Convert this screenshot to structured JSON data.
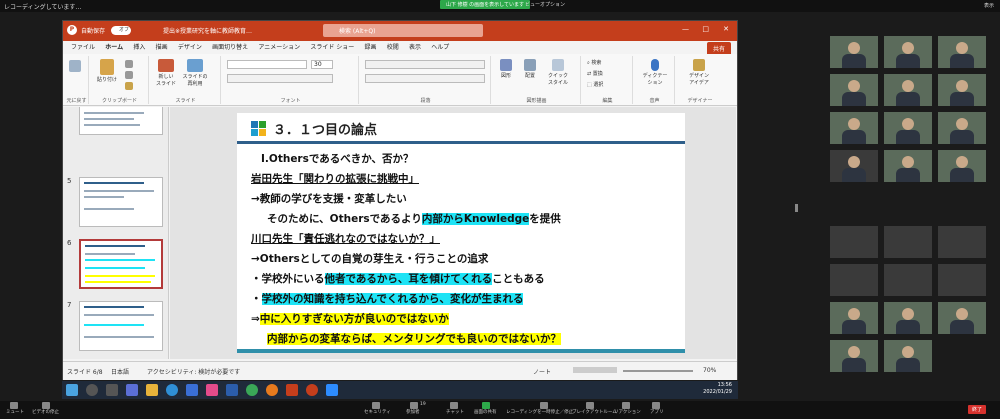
{
  "zoom": {
    "recording_label": "レコーディングしています…",
    "share_banner": "山下 修樹 の画面を表示しています",
    "view_options": "ビューオプション",
    "display_label": "表示",
    "bottom": {
      "mute": "ミュート",
      "video": "ビデオの停止",
      "security": "セキュリティ",
      "participants": "参加者",
      "participants_count": "19",
      "chat": "チャット",
      "share": "画面の共有",
      "record": "レコーディングを一時停止／停止",
      "breakout": "ブレイクアウトルーム",
      "reactions": "リアクション",
      "apps": "アプリ",
      "end": "終了"
    }
  },
  "ppt": {
    "autosave": "自動保存",
    "toggle": "オフ",
    "doc_title": "提出※授業研究を軸に教師教育…",
    "search_placeholder": "検索 (Alt+Q)",
    "menu": [
      "ファイル",
      "ホーム",
      "挿入",
      "描画",
      "デザイン",
      "画面切り替え",
      "アニメーション",
      "スライド ショー",
      "録画",
      "校閲",
      "表示",
      "ヘルプ"
    ],
    "share_button": "共有",
    "ribbon": {
      "undo": "元に戻す",
      "paste": "貼り付け",
      "clipboard": "クリップボード",
      "new_slide": "新しい\nスライド",
      "reuse_slide": "スライドの\n再利用",
      "slide_group": "スライド",
      "font_group": "フォント",
      "font_size": "30",
      "paragraph_group": "段落",
      "draw_group": "図形描画",
      "shapes": "図形",
      "arrange": "配置",
      "quick_styles": "クイック\nスタイル",
      "find": "検索",
      "replace": "置換",
      "select": "選択",
      "edit_group": "編集",
      "dictate": "ディクテー\nション",
      "voice_group": "音声",
      "designer": "デザイン\nアイデア",
      "designer_group": "デザイナー"
    },
    "thumbnails": [
      {
        "num": "5",
        "title": "３．Ｏｔｈｅｒｓとしての…"
      },
      {
        "num": "6",
        "title": "３．１つ目の論点"
      },
      {
        "num": "7",
        "title": "３．２つ目の論点"
      },
      {
        "num": "8",
        "title": "ポイント"
      }
    ],
    "slide": {
      "title": "３．１つ目の論点",
      "lines": [
        {
          "a": "Ⅰ.Othersであるべきか、否か？"
        },
        {
          "a": "岩田先生「関わりの拡張に挑戦中」"
        },
        {
          "a": "→教師の学びを支援・変革したい"
        },
        {
          "a": "そのために、Othersであるより",
          "hl": "内部からKnowledge",
          "b": "を提供"
        },
        {
          "a": "川口先生「責任逃れなのではないか？」"
        },
        {
          "a": "→Othersとしての自覚の芽生え・行うことの追求"
        },
        {
          "a": "・学校外にいる",
          "hl": "他者であるから、耳を傾けてくれる",
          "b": "こともある"
        },
        {
          "a": "・",
          "hl": "学校外の知識を持ち込んでくれるから、変化が生まれる"
        },
        {
          "a": "⇒",
          "hl": "中に入りすぎない方が良いのではないか"
        },
        {
          "a": "",
          "hl": "内部からの変革ならば、メンタリングでも良いのではないか？"
        }
      ]
    },
    "status": {
      "slide_count": "スライド 6/8",
      "language": "日本語",
      "accessibility": "アクセシビリティ: 検討が必要です",
      "notes": "ノート",
      "zoom": "70%"
    }
  },
  "taskbar": {
    "time": "13:56",
    "date": "2022/01/29"
  },
  "colors": {
    "ppt_accent": "#c43e1c",
    "highlight_cyan": "#1ee3f5",
    "highlight_yellow": "#ffff00",
    "zoom_green": "#2da84a",
    "end_red": "#d6322e"
  }
}
